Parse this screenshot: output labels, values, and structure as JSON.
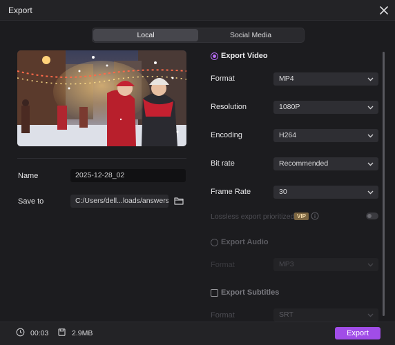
{
  "window": {
    "title": "Export"
  },
  "tabs": [
    {
      "label": "Local"
    },
    {
      "label": "Social Media"
    }
  ],
  "left": {
    "name_label": "Name",
    "name_value": "2025-12-28_02",
    "save_label": "Save to",
    "save_value": "C:/Users/dell...loads/answers"
  },
  "right": {
    "export_video_label": "Export Video",
    "rows": [
      {
        "label": "Format",
        "value": "MP4"
      },
      {
        "label": "Resolution",
        "value": "1080P"
      },
      {
        "label": "Encoding",
        "value": "H264"
      },
      {
        "label": "Bit rate",
        "value": "Recommended"
      },
      {
        "label": "Frame Rate",
        "value": "30"
      }
    ],
    "lossless_label": "Lossless export prioritized",
    "vip_badge": "VIP",
    "export_audio_label": "Export Audio",
    "audio_format_label": "Format",
    "audio_format_value": "MP3",
    "export_subtitles_label": "Export Subtitles",
    "subtitle_format_label": "Format",
    "subtitle_format_value": "SRT"
  },
  "footer": {
    "duration": "00:03",
    "size": "2.9MB",
    "export_label": "Export"
  },
  "colors": {
    "accent": "#a14de8",
    "radio_accent": "#b56cf2",
    "background": "#1c1c1f"
  }
}
